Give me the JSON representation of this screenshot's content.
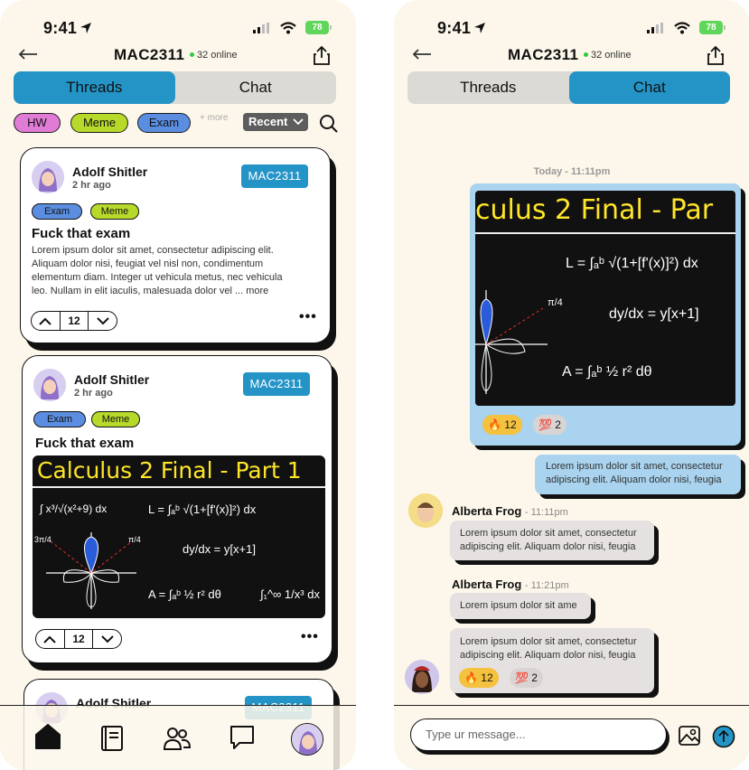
{
  "status": {
    "time": "9:41",
    "battery": "78"
  },
  "header": {
    "title": "MAC2311",
    "online": "32 online"
  },
  "tabs": [
    "Threads",
    "Chat"
  ],
  "filters": {
    "chips": [
      "HW",
      "Meme",
      "Exam"
    ],
    "more": "+ more",
    "sort": "Recent"
  },
  "posts": [
    {
      "author": "Adolf Shitler",
      "time": "2 hr ago",
      "course": "MAC2311",
      "tags": [
        "Exam",
        "Meme"
      ],
      "title": "Fuck that exam",
      "body": [
        "Lorem ipsum dolor sit amet, consectetur adipiscing elit.",
        "Aliquam dolor  nisi, feugiat vel nisl non, condimentum",
        "elementum diam. Integer ut  vehicula metus, nec vehicula",
        "leo. Nullam in elit iaculis, malesuada  dolor vel ... more"
      ],
      "votes": "12"
    },
    {
      "author": "Adolf Shitler",
      "time": "2 hr ago",
      "course": "MAC2311",
      "tags": [
        "Exam",
        "Meme"
      ],
      "title": "Fuck that exam",
      "votes": "12"
    },
    {
      "author": "Adolf Shitler",
      "course": "MAC2311"
    }
  ],
  "image": {
    "heading": "Calculus 2 Final - Part 1",
    "heading_cropped": "culus 2 Final - Par",
    "eq1": "L = ∫ₐᵇ √(1+[f'(x)]²) dx",
    "eq2": "dy/dx = y[x+1]",
    "eq3": "A = ∫ₐᵇ ½ r² dθ",
    "eq4": "∫₁^∞ 1/x³ dx",
    "eq5": "∫ x³/√(x²+9) dx",
    "frac1": "3π/4",
    "frac2": "π/4"
  },
  "chat": {
    "date": "Today - 11:11pm",
    "my_reacts": [
      {
        "emoji": "🔥",
        "count": "12"
      },
      {
        "emoji": "💯",
        "count": "2"
      }
    ],
    "my_text": [
      "Lorem ipsum dolor sit amet, consectetur",
      "adipiscing elit. Aliquam dolor  nisi, feugia"
    ],
    "messages": [
      {
        "author": "Alberta Frog",
        "time": "- 11:11pm",
        "text": [
          "Lorem ipsum dolor sit amet, consectetur",
          "adipiscing elit. Aliquam dolor  nisi, feugia"
        ]
      },
      {
        "author": "Alberta Frog",
        "time": "- 11:21pm",
        "text": [
          "Lorem ipsum dolor sit ame"
        ]
      },
      {
        "text": [
          "Lorem ipsum dolor sit amet, consectetur",
          "adipiscing elit. Aliquam dolor  nisi, feugia"
        ],
        "reacts": [
          {
            "emoji": "🔥",
            "count": "12"
          },
          {
            "emoji": "💯",
            "count": "2"
          }
        ]
      }
    ],
    "input_placeholder": "Type ur message..."
  },
  "colors": {
    "bg": "#fcf7ea",
    "blue": "#2494c7",
    "hw": "#e07bd6",
    "meme": "#b7d92a",
    "exam": "#5b8ee0",
    "bubble_me": "#a9d3ee",
    "bubble_other": "#e6e1e1"
  }
}
